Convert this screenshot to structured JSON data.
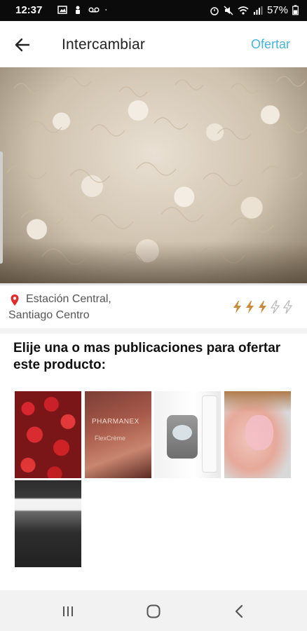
{
  "status_bar": {
    "time": "12:37",
    "battery": "57%"
  },
  "app_bar": {
    "title": "Intercambiar",
    "action_label": "Ofertar",
    "accent_color": "#47b4d8"
  },
  "listing": {
    "location_line1": "Estación Central,",
    "location_line2": "Santiago Centro",
    "rating_filled": 3,
    "rating_max": 5
  },
  "offer_section": {
    "instructions": "Elije una o mas publicaciones para ofertar este producto:",
    "thumbnails": [
      {
        "subject": "strawberries"
      },
      {
        "subject": "pharmanex-flexcreme",
        "brand_text": "PHARMANEX",
        "product_text": "FlexCrème"
      },
      {
        "subject": "skincare-device"
      },
      {
        "subject": "facial-mask"
      },
      {
        "subject": "interior-wall"
      }
    ]
  },
  "nav_bar": {
    "icons": [
      "recents-icon",
      "home-icon",
      "back-icon"
    ]
  }
}
